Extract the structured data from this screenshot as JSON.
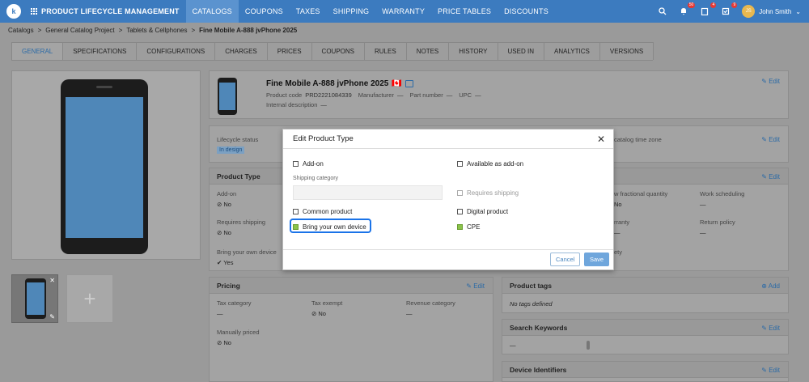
{
  "app": {
    "title": "PRODUCT LIFECYCLE MANAGEMENT",
    "logo": "k"
  },
  "nav": [
    "CATALOGS",
    "COUPONS",
    "TAXES",
    "SHIPPING",
    "WARRANTY",
    "PRICE TABLES",
    "DISCOUNTS"
  ],
  "top": {
    "badge1": "50",
    "badge2": "4",
    "badge3": "9",
    "user": "John Smith",
    "initials": "JS",
    "user_caret": "⌄"
  },
  "breadcrumb": [
    "Catalogs",
    ">",
    "General Catalog Project",
    ">",
    "Tablets & Cellphones",
    ">",
    "Fine Mobile A-888 jvPhone 2025"
  ],
  "tabs": [
    "GENERAL",
    "SPECIFICATIONS",
    "CONFIGURATIONS",
    "CHARGES",
    "PRICES",
    "COUPONS",
    "RULES",
    "NOTES",
    "HISTORY",
    "USED IN",
    "ANALYTICS",
    "VERSIONS"
  ],
  "product": {
    "name": "Fine Mobile A-888 jvPhone 2025",
    "flag": "🇨🇦",
    "code_label": "Product code",
    "code": "PRD2221084339",
    "manufacturer_label": "Manufacturer",
    "manufacturer": "—",
    "part_label": "Part number",
    "part": "—",
    "upc_label": "UPC",
    "upc": "—",
    "internal_label": "Internal description",
    "internal": "—",
    "edit": "✎ Edit"
  },
  "lifecycle": {
    "label": "Lifecycle status",
    "status": "In design",
    "tz_label": "catalog time zone",
    "edit": "✎ Edit"
  },
  "product_type": {
    "title": "Product Type",
    "edit": "✎ Edit",
    "addon_label": "Add-on",
    "addon": "⊘ No",
    "req_ship_label": "Requires shipping",
    "req_ship": "⊘ No",
    "byod_label": "Bring your own device",
    "byod": "✔ Yes",
    "frac_label": "w fractional quantity",
    "frac": "No",
    "work_label": "Work scheduling",
    "work": "—",
    "warranty_label": "rranty",
    "warranty": "—",
    "return_label": "Return policy",
    "return": "—",
    "safety_label": "ety"
  },
  "pricing": {
    "title": "Pricing",
    "edit": "✎ Edit",
    "tax_cat_label": "Tax category",
    "tax_cat": "—",
    "tax_ex_label": "Tax exempt",
    "tax_ex": "⊘ No",
    "rev_label": "Revenue category",
    "rev": "—",
    "manual_label": "Manually priced",
    "manual": "⊘ No"
  },
  "tags": {
    "title": "Product tags",
    "add": "⊕ Add",
    "empty": "No tags defined"
  },
  "keywords": {
    "title": "Search Keywords",
    "edit": "✎ Edit",
    "value": "—"
  },
  "device_ids": {
    "title": "Device Identifiers",
    "edit": "✎ Edit"
  },
  "thumb": {
    "close": "✕",
    "edit": "✎",
    "add": "+"
  },
  "modal": {
    "title": "Edit Product Type",
    "close": "✕",
    "addon": "Add-on",
    "avail_addon": "Available as add-on",
    "ship_cat": "Shipping category",
    "req_ship": "Requires shipping",
    "common": "Common product",
    "digital": "Digital product",
    "byod": "Bring your own device",
    "cpe": "CPE",
    "cancel": "Cancel",
    "save": "Save"
  }
}
